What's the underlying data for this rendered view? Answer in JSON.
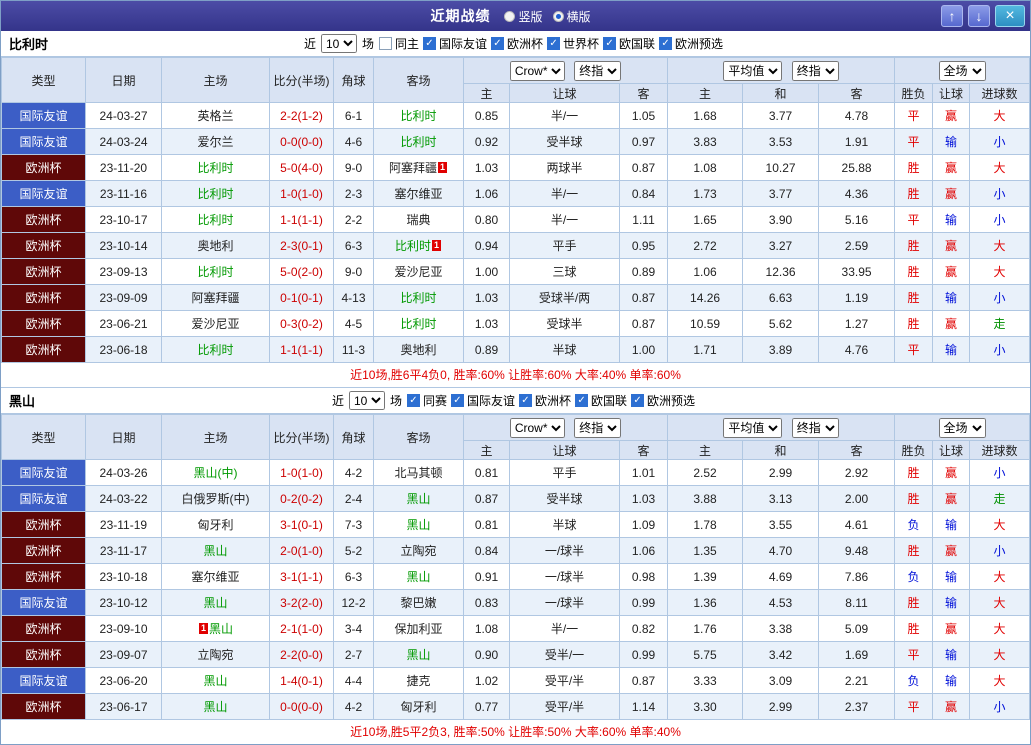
{
  "titlebar": {
    "title": "近期战绩",
    "layout_options": [
      {
        "label": "竖版",
        "checked": false
      },
      {
        "label": "横版",
        "checked": true
      }
    ]
  },
  "icons": {
    "check": "✓",
    "up": "↑",
    "down": "↓",
    "close": "×"
  },
  "colors": {
    "titlebar_bg": "#38388e",
    "friendly_badge": "#3c5ec6",
    "eurocup_badge": "#5f0808",
    "highlight_team_green": "#009900",
    "win_red": "#e10000",
    "lose_blue": "#0010d8",
    "push_green": "#009000",
    "score_red": "#cc0000",
    "header_bg": "#d9e3f3",
    "row_alt_bg": "#e9f1fa",
    "grid_border": "#b0c7e2"
  },
  "columns": {
    "static": [
      "类型",
      "日期",
      "主场",
      "比分(半场)",
      "角球",
      "客场"
    ],
    "sub": [
      "主",
      "让球",
      "客",
      "主",
      "和",
      "客",
      "胜负",
      "让球",
      "进球数"
    ]
  },
  "sections": [
    {
      "team": "比利时",
      "controls": {
        "near": "近",
        "count": "10",
        "unit": "场"
      },
      "filters": [
        {
          "label": "同主",
          "checked": false
        },
        {
          "label": "国际友谊",
          "checked": true
        },
        {
          "label": "欧洲杯",
          "checked": true
        },
        {
          "label": "世界杯",
          "checked": true
        },
        {
          "label": "欧国联",
          "checked": true
        },
        {
          "label": "欧洲预选",
          "checked": true
        }
      ],
      "selects": {
        "odds_source": "Crow*",
        "odds_time": "终指",
        "avg_source": "平均值",
        "avg_time": "终指",
        "range": "全场"
      },
      "rows": [
        {
          "type": "国际友谊",
          "type_key": "friendly",
          "date": "24-03-27",
          "home": {
            "name": "英格兰"
          },
          "score": "2-2(1-2)",
          "corner": "6-1",
          "away": {
            "name": "比利时",
            "hl": true
          },
          "odds": [
            "0.85",
            "半/一",
            "1.05"
          ],
          "avg": [
            "1.68",
            "3.77",
            "4.78"
          ],
          "results": [
            {
              "text": "平",
              "color": "red"
            },
            {
              "text": "赢",
              "color": "red"
            },
            {
              "text": "大",
              "color": "red"
            }
          ]
        },
        {
          "type": "国际友谊",
          "type_key": "friendly",
          "date": "24-03-24",
          "home": {
            "name": "爱尔兰"
          },
          "score": "0-0(0-0)",
          "corner": "4-6",
          "away": {
            "name": "比利时",
            "hl": true
          },
          "odds": [
            "0.92",
            "受半球",
            "0.97"
          ],
          "avg": [
            "3.83",
            "3.53",
            "1.91"
          ],
          "results": [
            {
              "text": "平",
              "color": "red"
            },
            {
              "text": "输",
              "color": "blue"
            },
            {
              "text": "小",
              "color": "blue"
            }
          ]
        },
        {
          "type": "欧洲杯",
          "type_key": "eurocup",
          "date": "23-11-20",
          "home": {
            "name": "比利时",
            "hl": true
          },
          "score": "5-0(4-0)",
          "corner": "9-0",
          "away": {
            "name": "阿塞拜疆",
            "card": "1"
          },
          "odds": [
            "1.03",
            "两球半",
            "0.87"
          ],
          "avg": [
            "1.08",
            "10.27",
            "25.88"
          ],
          "results": [
            {
              "text": "胜",
              "color": "red"
            },
            {
              "text": "赢",
              "color": "red"
            },
            {
              "text": "大",
              "color": "red"
            }
          ]
        },
        {
          "type": "国际友谊",
          "type_key": "friendly",
          "date": "23-11-16",
          "home": {
            "name": "比利时",
            "hl": true
          },
          "score": "1-0(1-0)",
          "corner": "2-3",
          "away": {
            "name": "塞尔维亚"
          },
          "odds": [
            "1.06",
            "半/一",
            "0.84"
          ],
          "avg": [
            "1.73",
            "3.77",
            "4.36"
          ],
          "results": [
            {
              "text": "胜",
              "color": "red"
            },
            {
              "text": "赢",
              "color": "red"
            },
            {
              "text": "小",
              "color": "blue"
            }
          ]
        },
        {
          "type": "欧洲杯",
          "type_key": "eurocup",
          "date": "23-10-17",
          "home": {
            "name": "比利时",
            "hl": true
          },
          "score": "1-1(1-1)",
          "corner": "2-2",
          "away": {
            "name": "瑞典"
          },
          "odds": [
            "0.80",
            "半/一",
            "1.11"
          ],
          "avg": [
            "1.65",
            "3.90",
            "5.16"
          ],
          "results": [
            {
              "text": "平",
              "color": "red"
            },
            {
              "text": "输",
              "color": "blue"
            },
            {
              "text": "小",
              "color": "blue"
            }
          ]
        },
        {
          "type": "欧洲杯",
          "type_key": "eurocup",
          "date": "23-10-14",
          "home": {
            "name": "奥地利"
          },
          "score": "2-3(0-1)",
          "corner": "6-3",
          "away": {
            "name": "比利时",
            "hl": true,
            "card": "1"
          },
          "odds": [
            "0.94",
            "平手",
            "0.95"
          ],
          "avg": [
            "2.72",
            "3.27",
            "2.59"
          ],
          "results": [
            {
              "text": "胜",
              "color": "red"
            },
            {
              "text": "赢",
              "color": "red"
            },
            {
              "text": "大",
              "color": "red"
            }
          ]
        },
        {
          "type": "欧洲杯",
          "type_key": "eurocup",
          "date": "23-09-13",
          "home": {
            "name": "比利时",
            "hl": true
          },
          "score": "5-0(2-0)",
          "corner": "9-0",
          "away": {
            "name": "爱沙尼亚"
          },
          "odds": [
            "1.00",
            "三球",
            "0.89"
          ],
          "avg": [
            "1.06",
            "12.36",
            "33.95"
          ],
          "results": [
            {
              "text": "胜",
              "color": "red"
            },
            {
              "text": "赢",
              "color": "red"
            },
            {
              "text": "大",
              "color": "red"
            }
          ]
        },
        {
          "type": "欧洲杯",
          "type_key": "eurocup",
          "date": "23-09-09",
          "home": {
            "name": "阿塞拜疆"
          },
          "score": "0-1(0-1)",
          "corner": "4-13",
          "away": {
            "name": "比利时",
            "hl": true
          },
          "odds": [
            "1.03",
            "受球半/两",
            "0.87"
          ],
          "avg": [
            "14.26",
            "6.63",
            "1.19"
          ],
          "results": [
            {
              "text": "胜",
              "color": "red"
            },
            {
              "text": "输",
              "color": "blue"
            },
            {
              "text": "小",
              "color": "blue"
            }
          ]
        },
        {
          "type": "欧洲杯",
          "type_key": "eurocup",
          "date": "23-06-21",
          "home": {
            "name": "爱沙尼亚"
          },
          "score": "0-3(0-2)",
          "corner": "4-5",
          "away": {
            "name": "比利时",
            "hl": true
          },
          "odds": [
            "1.03",
            "受球半",
            "0.87"
          ],
          "avg": [
            "10.59",
            "5.62",
            "1.27"
          ],
          "results": [
            {
              "text": "胜",
              "color": "red"
            },
            {
              "text": "赢",
              "color": "red"
            },
            {
              "text": "走",
              "color": "green"
            }
          ]
        },
        {
          "type": "欧洲杯",
          "type_key": "eurocup",
          "date": "23-06-18",
          "home": {
            "name": "比利时",
            "hl": true
          },
          "score": "1-1(1-1)",
          "corner": "11-3",
          "away": {
            "name": "奥地利"
          },
          "odds": [
            "0.89",
            "半球",
            "1.00"
          ],
          "avg": [
            "1.71",
            "3.89",
            "4.76"
          ],
          "results": [
            {
              "text": "平",
              "color": "red"
            },
            {
              "text": "输",
              "color": "blue"
            },
            {
              "text": "小",
              "color": "blue"
            }
          ]
        }
      ],
      "summary": "近10场,胜6平4负0, 胜率:60% 让胜率:60% 大率:40% 单率:60%"
    },
    {
      "team": "黑山",
      "controls": {
        "near": "近",
        "count": "10",
        "unit": "场"
      },
      "filters": [
        {
          "label": "同赛",
          "checked": true
        },
        {
          "label": "国际友谊",
          "checked": true
        },
        {
          "label": "欧洲杯",
          "checked": true
        },
        {
          "label": "欧国联",
          "checked": true
        },
        {
          "label": "欧洲预选",
          "checked": true
        }
      ],
      "selects": {
        "odds_source": "Crow*",
        "odds_time": "终指",
        "avg_source": "平均值",
        "avg_time": "终指",
        "range": "全场"
      },
      "rows": [
        {
          "type": "国际友谊",
          "type_key": "friendly",
          "date": "24-03-26",
          "home": {
            "name": "黑山(中)",
            "hl": true
          },
          "score": "1-0(1-0)",
          "corner": "4-2",
          "away": {
            "name": "北马其顿"
          },
          "odds": [
            "0.81",
            "平手",
            "1.01"
          ],
          "avg": [
            "2.52",
            "2.99",
            "2.92"
          ],
          "results": [
            {
              "text": "胜",
              "color": "red"
            },
            {
              "text": "赢",
              "color": "red"
            },
            {
              "text": "小",
              "color": "blue"
            }
          ]
        },
        {
          "type": "国际友谊",
          "type_key": "friendly",
          "date": "24-03-22",
          "home": {
            "name": "白俄罗斯(中)"
          },
          "score": "0-2(0-2)",
          "corner": "2-4",
          "away": {
            "name": "黑山",
            "hl": true
          },
          "odds": [
            "0.87",
            "受半球",
            "1.03"
          ],
          "avg": [
            "3.88",
            "3.13",
            "2.00"
          ],
          "results": [
            {
              "text": "胜",
              "color": "red"
            },
            {
              "text": "赢",
              "color": "red"
            },
            {
              "text": "走",
              "color": "green"
            }
          ]
        },
        {
          "type": "欧洲杯",
          "type_key": "eurocup",
          "date": "23-11-19",
          "home": {
            "name": "匈牙利"
          },
          "score": "3-1(0-1)",
          "corner": "7-3",
          "away": {
            "name": "黑山",
            "hl": true
          },
          "odds": [
            "0.81",
            "半球",
            "1.09"
          ],
          "avg": [
            "1.78",
            "3.55",
            "4.61"
          ],
          "results": [
            {
              "text": "负",
              "color": "blue"
            },
            {
              "text": "输",
              "color": "blue"
            },
            {
              "text": "大",
              "color": "red"
            }
          ]
        },
        {
          "type": "欧洲杯",
          "type_key": "eurocup",
          "date": "23-11-17",
          "home": {
            "name": "黑山",
            "hl": true
          },
          "score": "2-0(1-0)",
          "corner": "5-2",
          "away": {
            "name": "立陶宛"
          },
          "odds": [
            "0.84",
            "一/球半",
            "1.06"
          ],
          "avg": [
            "1.35",
            "4.70",
            "9.48"
          ],
          "results": [
            {
              "text": "胜",
              "color": "red"
            },
            {
              "text": "赢",
              "color": "red"
            },
            {
              "text": "小",
              "color": "blue"
            }
          ]
        },
        {
          "type": "欧洲杯",
          "type_key": "eurocup",
          "date": "23-10-18",
          "home": {
            "name": "塞尔维亚"
          },
          "score": "3-1(1-1)",
          "corner": "6-3",
          "away": {
            "name": "黑山",
            "hl": true
          },
          "odds": [
            "0.91",
            "一/球半",
            "0.98"
          ],
          "avg": [
            "1.39",
            "4.69",
            "7.86"
          ],
          "results": [
            {
              "text": "负",
              "color": "blue"
            },
            {
              "text": "输",
              "color": "blue"
            },
            {
              "text": "大",
              "color": "red"
            }
          ]
        },
        {
          "type": "国际友谊",
          "type_key": "friendly",
          "date": "23-10-12",
          "home": {
            "name": "黑山",
            "hl": true
          },
          "score": "3-2(2-0)",
          "corner": "12-2",
          "away": {
            "name": "黎巴嫩"
          },
          "odds": [
            "0.83",
            "一/球半",
            "0.99"
          ],
          "avg": [
            "1.36",
            "4.53",
            "8.11"
          ],
          "results": [
            {
              "text": "胜",
              "color": "red"
            },
            {
              "text": "输",
              "color": "blue"
            },
            {
              "text": "大",
              "color": "red"
            }
          ]
        },
        {
          "type": "欧洲杯",
          "type_key": "eurocup",
          "date": "23-09-10",
          "home": {
            "name": "黑山",
            "hl": true,
            "card": "1",
            "card_pre": true
          },
          "score": "2-1(1-0)",
          "corner": "3-4",
          "away": {
            "name": "保加利亚"
          },
          "odds": [
            "1.08",
            "半/一",
            "0.82"
          ],
          "avg": [
            "1.76",
            "3.38",
            "5.09"
          ],
          "results": [
            {
              "text": "胜",
              "color": "red"
            },
            {
              "text": "赢",
              "color": "red"
            },
            {
              "text": "大",
              "color": "red"
            }
          ]
        },
        {
          "type": "欧洲杯",
          "type_key": "eurocup",
          "date": "23-09-07",
          "home": {
            "name": "立陶宛"
          },
          "score": "2-2(0-0)",
          "corner": "2-7",
          "away": {
            "name": "黑山",
            "hl": true
          },
          "odds": [
            "0.90",
            "受半/一",
            "0.99"
          ],
          "avg": [
            "5.75",
            "3.42",
            "1.69"
          ],
          "results": [
            {
              "text": "平",
              "color": "red"
            },
            {
              "text": "输",
              "color": "blue"
            },
            {
              "text": "大",
              "color": "red"
            }
          ]
        },
        {
          "type": "国际友谊",
          "type_key": "friendly",
          "date": "23-06-20",
          "home": {
            "name": "黑山",
            "hl": true
          },
          "score": "1-4(0-1)",
          "corner": "4-4",
          "away": {
            "name": "捷克"
          },
          "odds": [
            "1.02",
            "受平/半",
            "0.87"
          ],
          "avg": [
            "3.33",
            "3.09",
            "2.21"
          ],
          "results": [
            {
              "text": "负",
              "color": "blue"
            },
            {
              "text": "输",
              "color": "blue"
            },
            {
              "text": "大",
              "color": "red"
            }
          ]
        },
        {
          "type": "欧洲杯",
          "type_key": "eurocup",
          "date": "23-06-17",
          "home": {
            "name": "黑山",
            "hl": true
          },
          "score": "0-0(0-0)",
          "corner": "4-2",
          "away": {
            "name": "匈牙利"
          },
          "odds": [
            "0.77",
            "受平/半",
            "1.14"
          ],
          "avg": [
            "3.30",
            "2.99",
            "2.37"
          ],
          "results": [
            {
              "text": "平",
              "color": "red"
            },
            {
              "text": "赢",
              "color": "red"
            },
            {
              "text": "小",
              "color": "blue"
            }
          ]
        }
      ],
      "summary": "近10场,胜5平2负3, 胜率:50% 让胜率:50% 大率:60% 单率:40%"
    }
  ]
}
